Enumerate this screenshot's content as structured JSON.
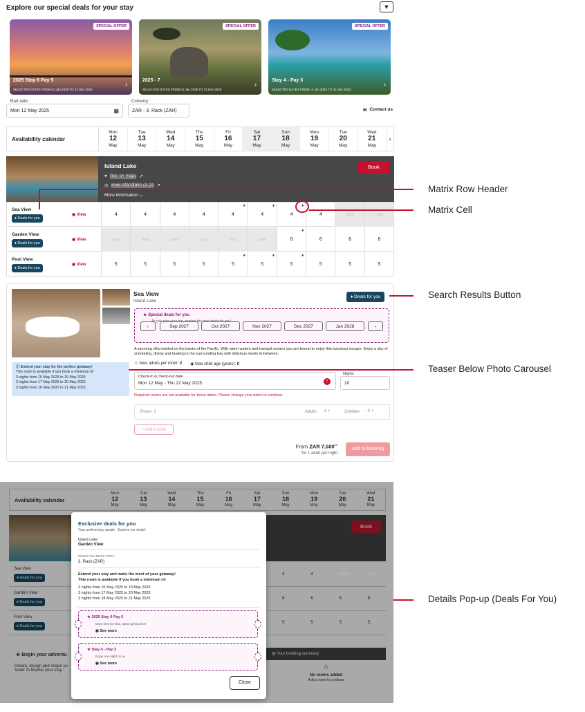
{
  "header": {
    "title": "Explore our special deals for your stay",
    "filter_icon": "filter-icon"
  },
  "deals": [
    {
      "badge": "SPECIAL OFFER",
      "name": "2025 Stay 6 Pay 5",
      "dates": "SELECTED DATES FROM 01 Jan 2025 TO 31 Dec 2025"
    },
    {
      "badge": "SPECIAL OFFER",
      "name": "2025 - 7",
      "dates": "SELECTED DATES FROM 01 Jan 2025 TO 31 Dec 2025"
    },
    {
      "badge": "SPECIAL OFFER",
      "name": "Stay 4 - Pay 3",
      "dates": "SELECTED DATES FROM 11 Jan 2023 TO 31 Dec 2030"
    }
  ],
  "search": {
    "start_label": "Start date",
    "start_value": "Mon 12 May 2025",
    "currency_label": "Currency",
    "currency_value": "ZAR - 3. Rack (ZAR)",
    "contact": "Contact us"
  },
  "calendar": {
    "label": "Availability calendar",
    "days": [
      {
        "dow": "Mon",
        "day": "12",
        "mon": "May"
      },
      {
        "dow": "Tue",
        "day": "13",
        "mon": "May"
      },
      {
        "dow": "Wed",
        "day": "14",
        "mon": "May"
      },
      {
        "dow": "Thu",
        "day": "15",
        "mon": "May"
      },
      {
        "dow": "Fri",
        "day": "16",
        "mon": "May"
      },
      {
        "dow": "Sat",
        "day": "17",
        "mon": "May"
      },
      {
        "dow": "Sun",
        "day": "18",
        "mon": "May"
      },
      {
        "dow": "Mon",
        "day": "19",
        "mon": "May"
      },
      {
        "dow": "Tue",
        "day": "20",
        "mon": "May"
      },
      {
        "dow": "Wed",
        "day": "21",
        "mon": "May"
      }
    ]
  },
  "hotel": {
    "name": "Island Lake",
    "maps": "See on maps",
    "website": "www.islandlake.co.za",
    "more": "More information",
    "book": "Book"
  },
  "matrix": {
    "deals_label": "Deals for you",
    "view_label": "View",
    "rows": [
      {
        "name": "Sea View",
        "cells": [
          "4",
          "4",
          "4",
          "4",
          "4",
          "4",
          "4",
          "4",
          "Sold",
          "Sold"
        ],
        "tags": [
          4,
          5,
          6
        ]
      },
      {
        "name": "Garden View",
        "cells": [
          "Sold",
          "Sold",
          "Sold",
          "Sold",
          "Sold",
          "Sold",
          "6",
          "6",
          "6",
          "6"
        ],
        "tags": [
          6
        ]
      },
      {
        "name": "Pool View",
        "cells": [
          "5",
          "5",
          "5",
          "5",
          "5",
          "5",
          "5",
          "5",
          "5",
          "5"
        ],
        "tags": [
          4,
          5,
          6
        ]
      }
    ]
  },
  "result": {
    "room": "Sea View",
    "hotel": "Island Lake",
    "deals_btn": "Deals for you",
    "special_title": "Special deals for you",
    "special_sub": "As you plan your trip, explore the best deals for you!",
    "months": [
      "Sep 2027",
      "Oct 2027",
      "Nov 2027",
      "Dec 2027",
      "Jan 2028"
    ],
    "desc": "A stunning villa nestled on the banks of the Pacific. With warm waters and tranquil oceans you are bound to enjoy this luxurious escape. Enjoy a day of snorkeling, diving and boating in the surrounding bay with delicious meals in-between.",
    "max_adults": "Max adults per room:",
    "max_adults_val": "2",
    "max_child": "Max child age (years):",
    "max_child_val": "0",
    "checkin_label": "Check-in & check-out date",
    "checkin_value": "Mon 12 May  -  Thu 22 May 2025",
    "nights_label": "Nights",
    "nights_value": "10",
    "error": "Required rooms are not available for these dates. Please change your dates to continue.",
    "room_label": "Room: 1",
    "adults": "Adults",
    "adults_val": "1",
    "children": "Children",
    "children_val": "0",
    "add_room": "+  Add a room",
    "from": "From",
    "price": "ZAR 7,500",
    "price_sup": "00",
    "per": "for 1 adult per night",
    "add_booking": "Add to booking",
    "teaser_title": "Extend your stay for the perfect getaway!",
    "teaser_sub": "This room is available if you book a minimum of:",
    "teaser_lines": [
      "3 nights from 16 May 2025 to 19 May 2025",
      "3 nights from 17 May 2025 to 20 May 2025",
      "3 nights from 18 May 2025 to 21 May 2025"
    ]
  },
  "annotations": [
    "Matrix Row Header",
    "Matrix Cell",
    "Search Results Button",
    "Teaser Below Photo Carousel",
    "Details Pop-up (Deals For You)"
  ],
  "shot2": {
    "calendar_label": "Availability calendar",
    "book": "Book",
    "rows": [
      "Sea View",
      "Garden View",
      "Pool View"
    ],
    "deals_label": "Deals for you",
    "begin": "Begin your adventu",
    "begin_text": "Dream, design and shape yo",
    "begin_text2": "'book' to finalise your stay.",
    "summary": "Your booking summary",
    "no_rooms": "No rooms added",
    "add_room_hint": "Add a room to continue"
  },
  "popup": {
    "title": "Exclusive deals for you",
    "subtitle": "Your perfect stay awaits - Explore our deals!",
    "hotel": "Island Lake",
    "room": "Garden View",
    "book_with_label": "WHEN YOU BOOK WITH:",
    "rate": "3. Rack (ZAR)",
    "rate_bold": "(ZAR)",
    "extend_title": "Extend your stay and make the most of your getaway!",
    "extend_sub": "This room is available if you book a minimum of:",
    "lines": [
      "3 nights from 16 May 2025 to 19 May 2025",
      "3 nights from 17 May 2025 to 20 May 2025",
      "3 nights from 18 May 2025 to 21 May 2025"
    ],
    "deals": [
      {
        "name": "2025 Stay 6 Pay 5",
        "desc": "More time to relax, same great price!",
        "see": "See more"
      },
      {
        "name": "Stay 4 - Pay 3",
        "desc": "Enjoy one night on us",
        "see": "See more"
      }
    ],
    "close": "Close"
  }
}
